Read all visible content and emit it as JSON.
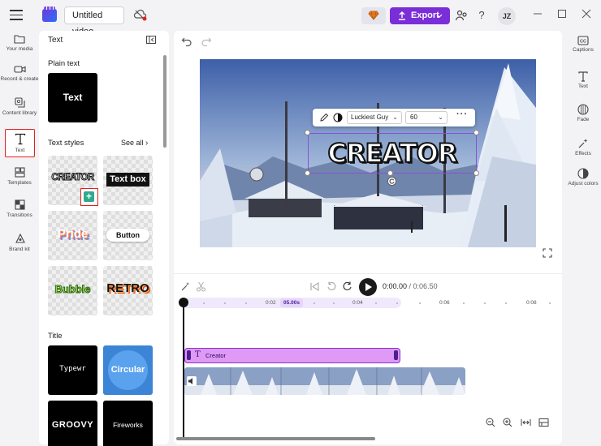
{
  "window": {
    "title_value": "Untitled video",
    "export_label": "Export",
    "avatar_initials": "JZ",
    "help_glyph": "?"
  },
  "left_rail": [
    {
      "label": "Your media",
      "icon": "folder-icon"
    },
    {
      "label": "Record & create",
      "icon": "camera-icon"
    },
    {
      "label": "Content library",
      "icon": "library-icon"
    },
    {
      "label": "Text",
      "icon": "text-icon",
      "active": true
    },
    {
      "label": "Templates",
      "icon": "templates-icon"
    },
    {
      "label": "Transitions",
      "icon": "transitions-icon"
    },
    {
      "label": "Brand kit",
      "icon": "brand-kit-icon"
    }
  ],
  "panel": {
    "title": "Text",
    "plain_text_title": "Plain text",
    "plain_text_tile": "Text",
    "text_styles_title": "Text styles",
    "see_all": "See all",
    "styles": [
      "CREATOR",
      "Text box",
      "Pride",
      "Button",
      "Bubble",
      "RETRO"
    ],
    "title_section": "Title",
    "titles": [
      "Typewr",
      "Circular",
      "GROOVY",
      "Fireworks"
    ],
    "add_glyph": "+"
  },
  "preview": {
    "overlay_text": "CREATOR",
    "font_name": "Luckiest Guy",
    "font_size": "60",
    "more_glyph": "···"
  },
  "playback": {
    "current_time": "0:00.00",
    "duration": "/ 0:06.50"
  },
  "timeline": {
    "ticks": [
      "0:02",
      "0:04",
      "0:06",
      "0:08"
    ],
    "current_marker": "05.00s",
    "text_clip_label": "Creator"
  },
  "right_rail": [
    {
      "label": "Captions",
      "icon": "captions-icon"
    },
    {
      "label": "Text",
      "icon": "text-icon"
    },
    {
      "label": "Fade",
      "icon": "fade-icon"
    },
    {
      "label": "Effects",
      "icon": "effects-icon"
    },
    {
      "label": "Adjust colors",
      "icon": "adjust-colors-icon"
    }
  ],
  "colors": {
    "accent": "#7a2ed8",
    "highlight_red": "#e0201c",
    "text_clip": "#df9af6"
  }
}
